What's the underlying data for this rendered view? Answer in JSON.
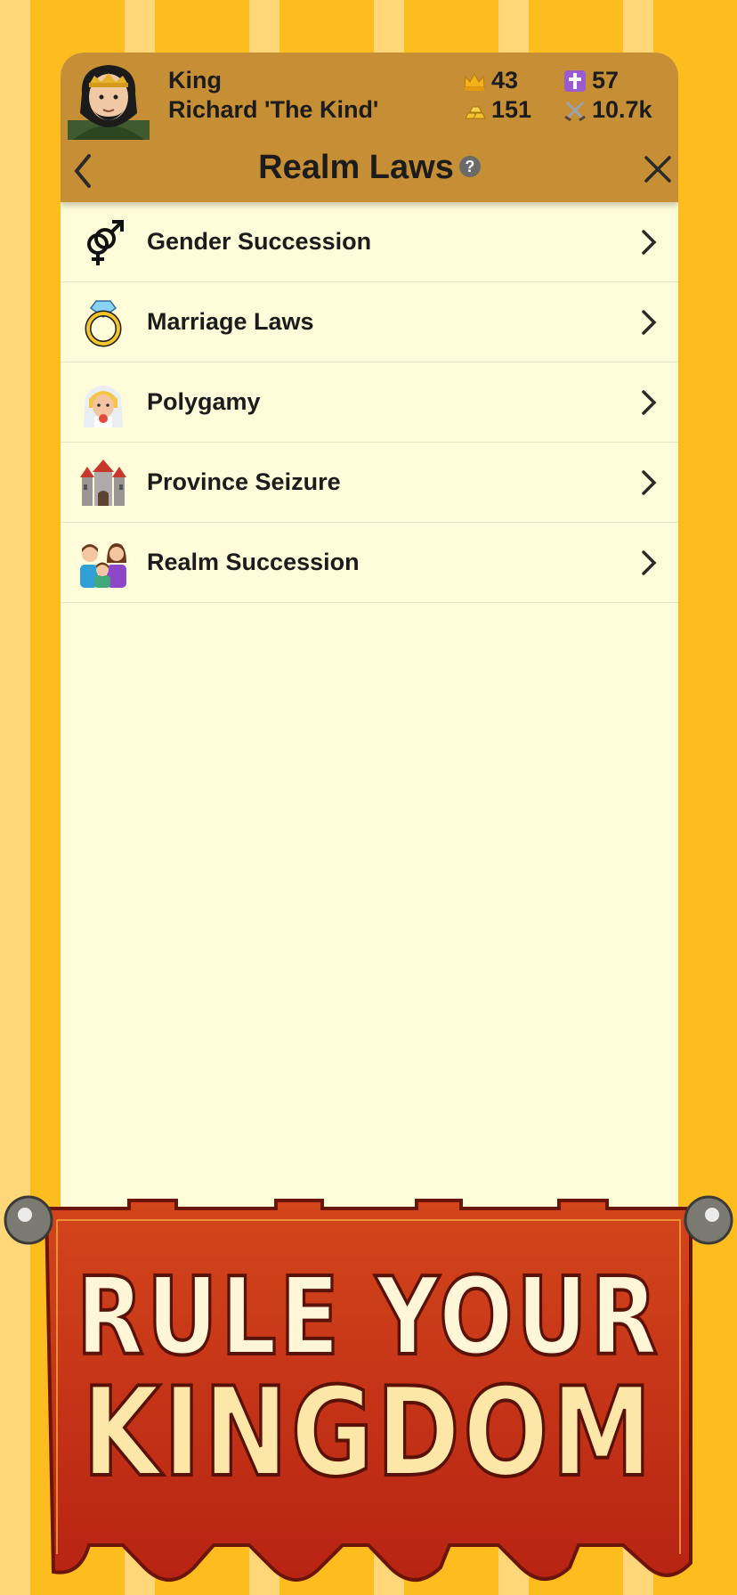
{
  "player": {
    "title": "King",
    "name": "Richard 'The Kind'"
  },
  "stats": {
    "crowns": "43",
    "faith": "57",
    "gold": "151",
    "army": "10.7k"
  },
  "header": {
    "title": "Realm Laws",
    "help": "?"
  },
  "laws": [
    {
      "label": "Gender Succession",
      "icon": "gender-symbol-icon"
    },
    {
      "label": "Marriage Laws",
      "icon": "ring-icon"
    },
    {
      "label": "Polygamy",
      "icon": "bride-icon"
    },
    {
      "label": "Province Seizure",
      "icon": "castle-icon"
    },
    {
      "label": "Realm Succession",
      "icon": "family-icon"
    }
  ],
  "banner": {
    "line1": "RULE YOUR",
    "line2": "KINGDOM"
  },
  "colors": {
    "header": "#c68f35",
    "panel": "#fffcd9",
    "stripe_dark": "#fdbd1f",
    "stripe_light": "#ffd779",
    "banner": "#c9391a"
  }
}
